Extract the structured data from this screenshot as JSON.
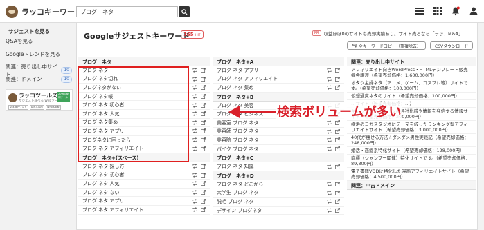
{
  "header": {
    "logo_text": "ラッコキーワード",
    "search_value": "ブログ　ネタ"
  },
  "sidebar": {
    "items": [
      {
        "label": "サジェストを見る",
        "badge": ""
      },
      {
        "label": "Q&Aを見る",
        "badge": ""
      },
      {
        "label": "Googleトレンドを見る",
        "badge": ""
      },
      {
        "label": "関連：売り出し中サイト",
        "badge": "10"
      },
      {
        "label": "関連：ドメイン",
        "badge": "10"
      }
    ],
    "banner": {
      "title": "ラッコツールズ",
      "subtitle": "サジェスト調べる Webツール",
      "green_text": "20個の便利ツール",
      "tags": [
        "文字数カウント",
        "見出し抽出",
        "Whois検索"
      ]
    }
  },
  "main": {
    "title": "Googleサジェストキーワード",
    "hit_count": "165",
    "hit_unit": "HIT",
    "pr_tag": "PR",
    "pr_text": "収益ほぼ0のサイトも売却実績あり。サイト売るなら「ラッコM&A」",
    "copy_button": "全キーワードコピー（重複除去）",
    "csv_button": "CSVダウンロード"
  },
  "col1": {
    "head1": "ブログ　ネタ",
    "rows1": [
      "ブログ ネタ",
      "ブログ ネタ切れ",
      "ブログネタがない",
      "ブログ ネタ帳",
      "ブログ ネタ 初心者",
      "ブログ ネタ 人気",
      "ブログ ネタ集め",
      "ブログ ネタ アプリ",
      "ブログネタに困ったら",
      "ブログ ネタ アフィリエイト"
    ],
    "head2": "ブログ　ネタ+(スペース)",
    "rows2": [
      "ブログ ネタ 探し方",
      "ブログ ネタ 初心者",
      "ブログ ネタ 人気",
      "ブログ ネタ ない",
      "ブログ ネタ アプリ",
      "ブログ ネタ アフィリエイト"
    ]
  },
  "col2": {
    "head1": "ブログ　ネタ+A",
    "rows1": [
      "ブログ ネタ アプリ",
      "ブログ ネタ アフィリエイト",
      "ブログ ネタ 集め"
    ],
    "head2": "ブログ　ネタ+B",
    "rows2": [
      "ブログ ネタ 美容",
      "ブログ ネタ ビジネス",
      "美容室 ブログ ネタ",
      "美容師 ブログ ネタ",
      "美容院 ブログ ネタ",
      "バイク ブログ ネタ"
    ],
    "head3": "ブログ　ネタ+C",
    "rows3": [
      "ブログ ネタ 知識"
    ],
    "head4": "ブログ　ネタ+D",
    "rows4": [
      "ブログ ネタ どこから",
      "大学生 ブログ ネタ",
      "脱毛 ブログ ネタ",
      "デザイン ブログネタ"
    ]
  },
  "col3": {
    "head1": "関連：売り出し中サイト",
    "rows1": [
      "アフィリエイト向きWordPress・HTMLテンプレート販売機会譲渡（希望売却価格：1,600,000円）",
      "オタク主婦ネタ（アニメ、ゲーム、コスプレ等）サイトです。（希望売却価格：100,000円）",
      "仮想通貨ネタのサイト（希望売却価格：100,000円）",
      "…サイト（希望売却価格：…）",
      "キャッシングやローンの各社比較や情報を発信する情報サイト（希望売却価格：200,000円）",
      "横浜のヨガスタジオにテーマを絞ったランキング型アフィリエイトサイト（希望売却価格：3,000,000円）",
      "40代が痩せる方法☆ダメダメ男性実践記（希望売却価格：248,000円）",
      "婚活・恋愛系特化サイト（希望売却価格：128,000円）",
      "商標（シャンプー関連）特化サイトです。（希望売却価格：89,800円）",
      "電子書籍VODに特化した漫画アフィリエイトサイト（希望売却価格：4,500,000円）"
    ],
    "head2": "関連：中古ドメイン"
  },
  "annotation": {
    "text": "検索ボリュームが多い",
    "color": "#d9202a"
  }
}
